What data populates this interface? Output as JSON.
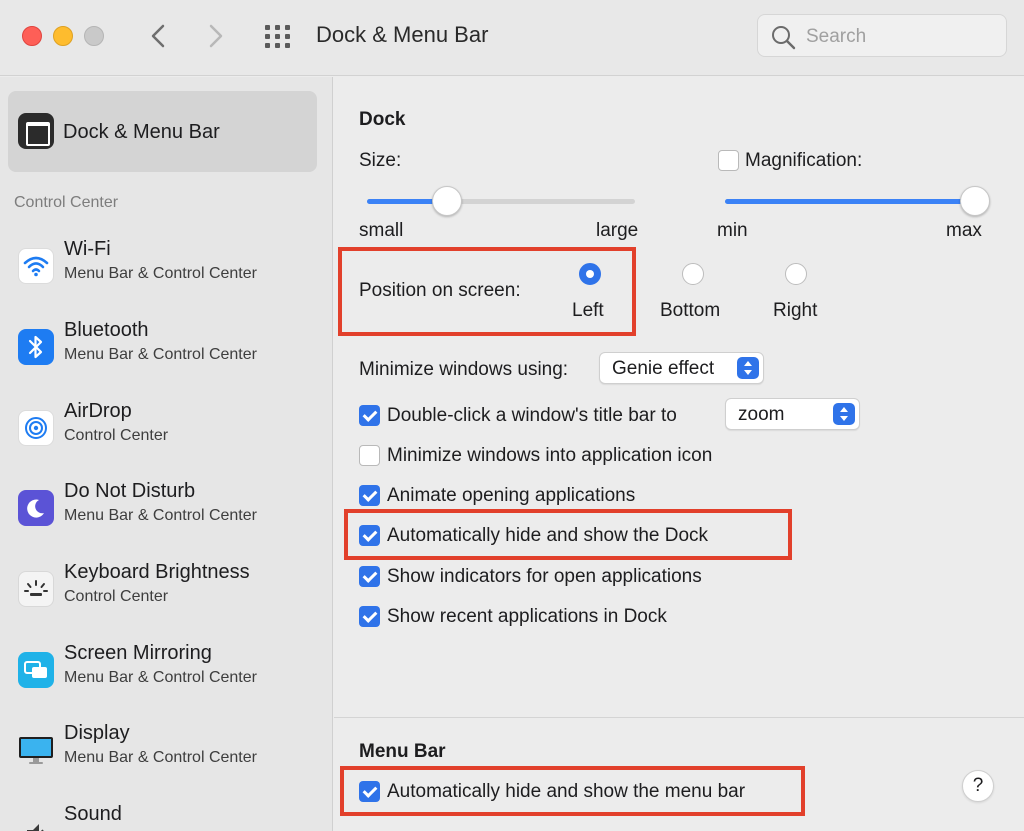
{
  "window": {
    "title": "Dock & Menu Bar"
  },
  "search": {
    "placeholder": "Search"
  },
  "sidebar": {
    "selected": {
      "label": "Dock & Menu Bar"
    },
    "section_label": "Control Center",
    "items": [
      {
        "name": "Wi-Fi",
        "subtitle": "Menu Bar & Control Center",
        "icon": "wifi-icon"
      },
      {
        "name": "Bluetooth",
        "subtitle": "Menu Bar & Control Center",
        "icon": "bluetooth-icon"
      },
      {
        "name": "AirDrop",
        "subtitle": "Control Center",
        "icon": "airdrop-icon"
      },
      {
        "name": "Do Not Disturb",
        "subtitle": "Menu Bar & Control Center",
        "icon": "moon-icon"
      },
      {
        "name": "Keyboard Brightness",
        "subtitle": "Control Center",
        "icon": "keyboard-brightness-icon"
      },
      {
        "name": "Screen Mirroring",
        "subtitle": "Menu Bar & Control Center",
        "icon": "screen-mirroring-icon"
      },
      {
        "name": "Display",
        "subtitle": "Menu Bar & Control Center",
        "icon": "display-icon"
      },
      {
        "name": "Sound",
        "subtitle": "",
        "icon": "sound-icon"
      }
    ]
  },
  "dock": {
    "title": "Dock",
    "size_label": "Size:",
    "size_min": "small",
    "size_max": "large",
    "size_value": 0.3,
    "magnification_label": "Magnification:",
    "magnification_checked": false,
    "mag_min": "min",
    "mag_max": "max",
    "mag_value": 1.0,
    "position_label": "Position on screen:",
    "positions": [
      {
        "label": "Left",
        "selected": true
      },
      {
        "label": "Bottom",
        "selected": false
      },
      {
        "label": "Right",
        "selected": false
      }
    ],
    "minimize_label": "Minimize windows using:",
    "minimize_value": "Genie effect",
    "doubleclick_label": "Double-click a window's title bar to",
    "doubleclick_value": "zoom",
    "options": [
      {
        "label": "Minimize windows into application icon",
        "checked": false
      },
      {
        "label": "Animate opening applications",
        "checked": true
      },
      {
        "label": "Automatically hide and show the Dock",
        "checked": true
      },
      {
        "label": "Show indicators for open applications",
        "checked": true
      },
      {
        "label": "Show recent applications in Dock",
        "checked": true
      }
    ]
  },
  "menubar": {
    "title": "Menu Bar",
    "autohide_label": "Automatically hide and show the menu bar",
    "autohide_checked": true
  },
  "help": {
    "label": "?"
  },
  "colors": {
    "accent": "#2f73e9",
    "highlight": "#e2402b"
  }
}
